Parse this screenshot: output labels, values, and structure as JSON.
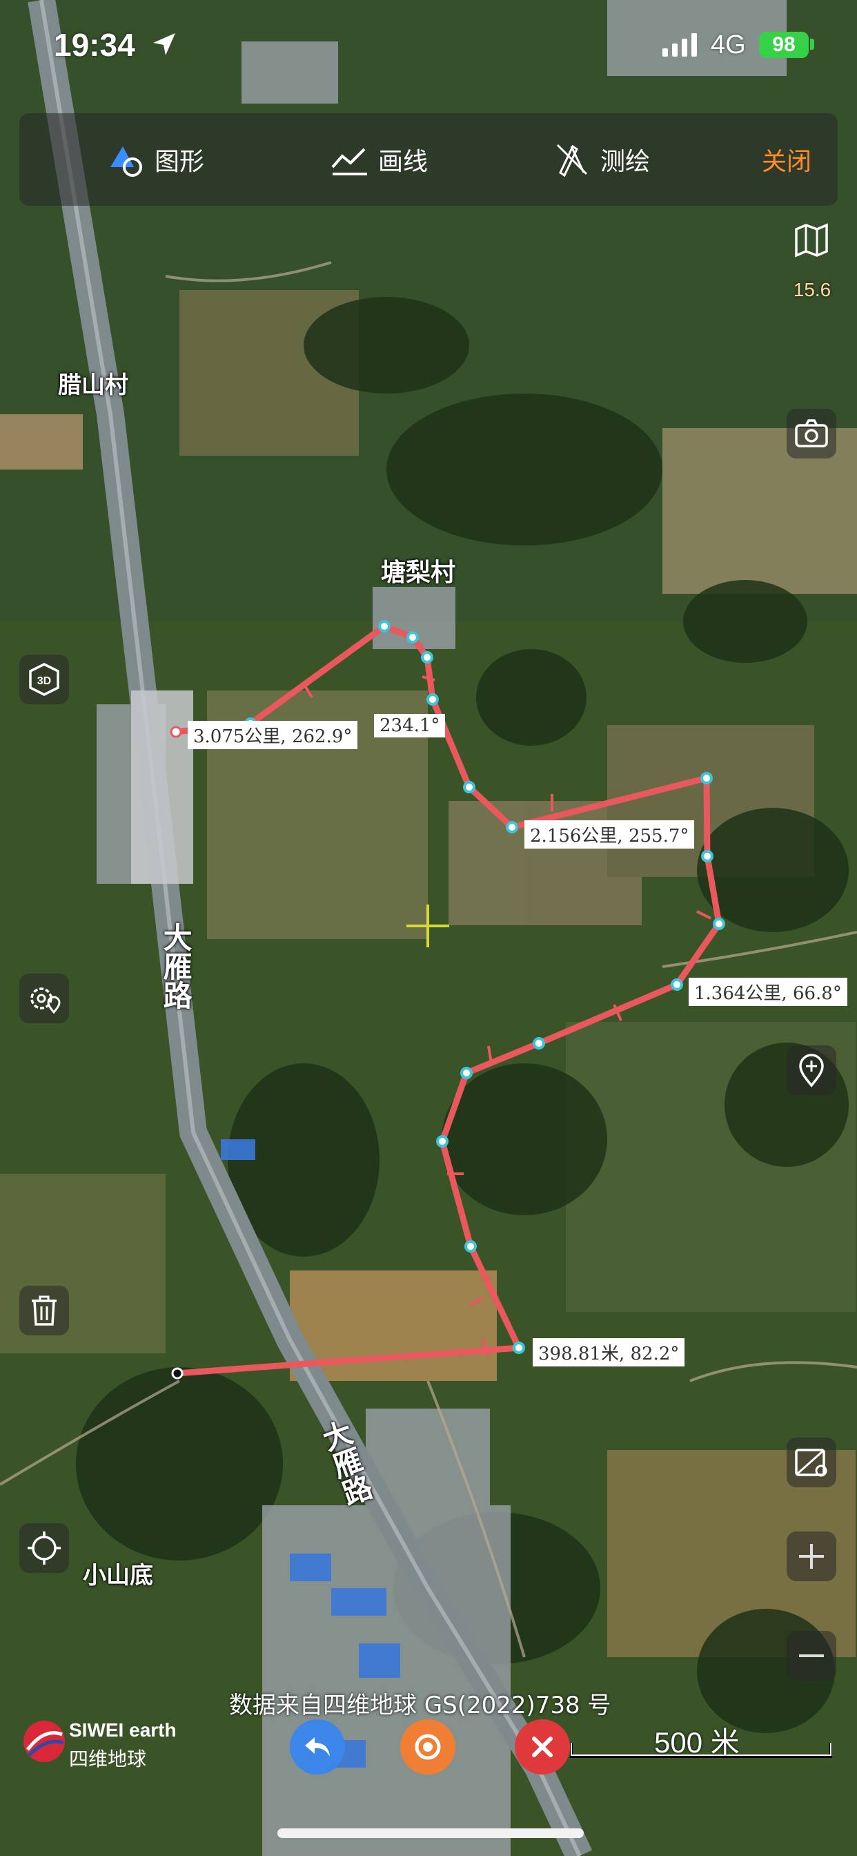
{
  "status_bar": {
    "time": "19:34",
    "network": "4G",
    "battery": "98",
    "battery_color": "#37d148"
  },
  "toolbar": {
    "shape_label": "图形",
    "draw_line_label": "画线",
    "survey_label": "测绘",
    "close_label": "关闭",
    "close_color": "#ff8a2a"
  },
  "map": {
    "zoom_level": "15.6",
    "places": {
      "lashan": "腊山村",
      "tangli": "塘梨村",
      "dayan_road_1": "大雁路",
      "dayan_road_2": "大雁路",
      "xiaoshandi": "小山底"
    },
    "measurements": {
      "m1": "3.075公里, 262.9°",
      "m2": "2.156公里, 255.7°",
      "m3": "1.364公里, 66.8°",
      "m4": "398.81米, 82.2°",
      "m5_partial": "234.1°"
    },
    "route_color": "#e8585c",
    "vertex_color": "#3ec3d8"
  },
  "attribution": "数据来自四维地球 GS(2022)738 号",
  "logo": {
    "en": "SIWEI earth",
    "cn": "四维地球"
  },
  "scale_bar": {
    "label": "500 米"
  },
  "icons": {
    "shape": "triangle-circle-icon",
    "line": "polyline-icon",
    "survey": "compass-pencil-icon",
    "layers": "map-layers-icon",
    "camera": "camera-icon",
    "three_d": "3d-cube-icon",
    "settings": "gear-location-icon",
    "add_marker": "add-pin-icon",
    "delete": "trash-icon",
    "locate": "crosshair-icon",
    "map_pin": "map-pin-icon",
    "zoom_in": "plus-icon",
    "zoom_out": "minus-icon",
    "undo": "undo-icon",
    "record": "record-icon",
    "cancel": "close-icon"
  }
}
